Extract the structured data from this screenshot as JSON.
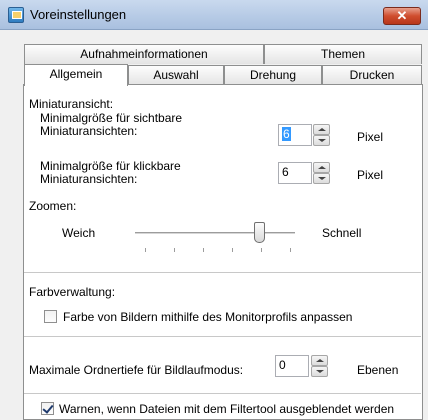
{
  "window": {
    "title": "Voreinstellungen",
    "close_glyph": "✕"
  },
  "tabs_row1": [
    "Aufnahmeinformationen",
    "Themen"
  ],
  "tabs_row2": [
    "Allgemein",
    "Auswahl",
    "Drehung",
    "Drucken"
  ],
  "active_tab": "Allgemein",
  "thumbnail": {
    "heading": "Miniaturansicht:",
    "visible_label": "Minimalgröße für sichtbare Miniaturansichten:",
    "visible_value": "6",
    "clickable_label": "Minimalgröße für klickbare Miniaturansichten:",
    "clickable_value": "6",
    "unit": "Pixel"
  },
  "zoom": {
    "heading": "Zoomen:",
    "min_label": "Weich",
    "max_label": "Schnell",
    "level_fraction": 0.75
  },
  "color": {
    "heading": "Farbverwaltung:",
    "checkbox_label": "Farbe von Bildern mithilfe des Monitorprofils anpassen",
    "checked": false
  },
  "depth": {
    "label": "Maximale Ordnertiefe für Bildlaufmodus:",
    "value": "0",
    "unit": "Ebenen"
  },
  "warn": {
    "checkbox_label": "Warnen, wenn Dateien mit dem Filtertool ausgeblendet werden",
    "checked": true
  }
}
